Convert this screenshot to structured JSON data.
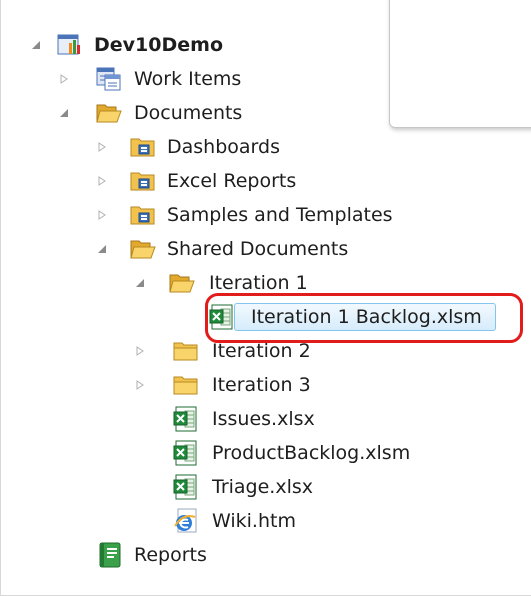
{
  "tree": {
    "root_label": "Dev10Demo",
    "work_items_label": "Work Items",
    "documents_label": "Documents",
    "dashboards_label": "Dashboards",
    "excel_reports_label": "Excel Reports",
    "samples_label": "Samples and Templates",
    "shared_documents_label": "Shared Documents",
    "iteration1_label": "Iteration 1",
    "iteration1_backlog_label": "Iteration 1 Backlog.xlsm",
    "iteration2_label": "Iteration 2",
    "iteration3_label": "Iteration 3",
    "issues_label": "Issues.xlsx",
    "product_backlog_label": "ProductBacklog.xlsm",
    "triage_label": "Triage.xlsx",
    "wiki_label": "Wiki.htm",
    "reports_label": "Reports"
  },
  "colors": {
    "selection_border": "#84c5ef",
    "highlight_ring": "#e21b1b",
    "folder": "#f2c24f",
    "excel_green": "#1f8a3a"
  },
  "icons": {
    "root": "team-project-icon",
    "work_items": "work-items-icon",
    "folder_open": "folder-open-icon",
    "folder_closed": "folder-icon",
    "document_library": "document-library-folder-icon",
    "excel": "excel-file-icon",
    "web": "ie-web-file-icon",
    "reports": "reports-book-icon"
  }
}
